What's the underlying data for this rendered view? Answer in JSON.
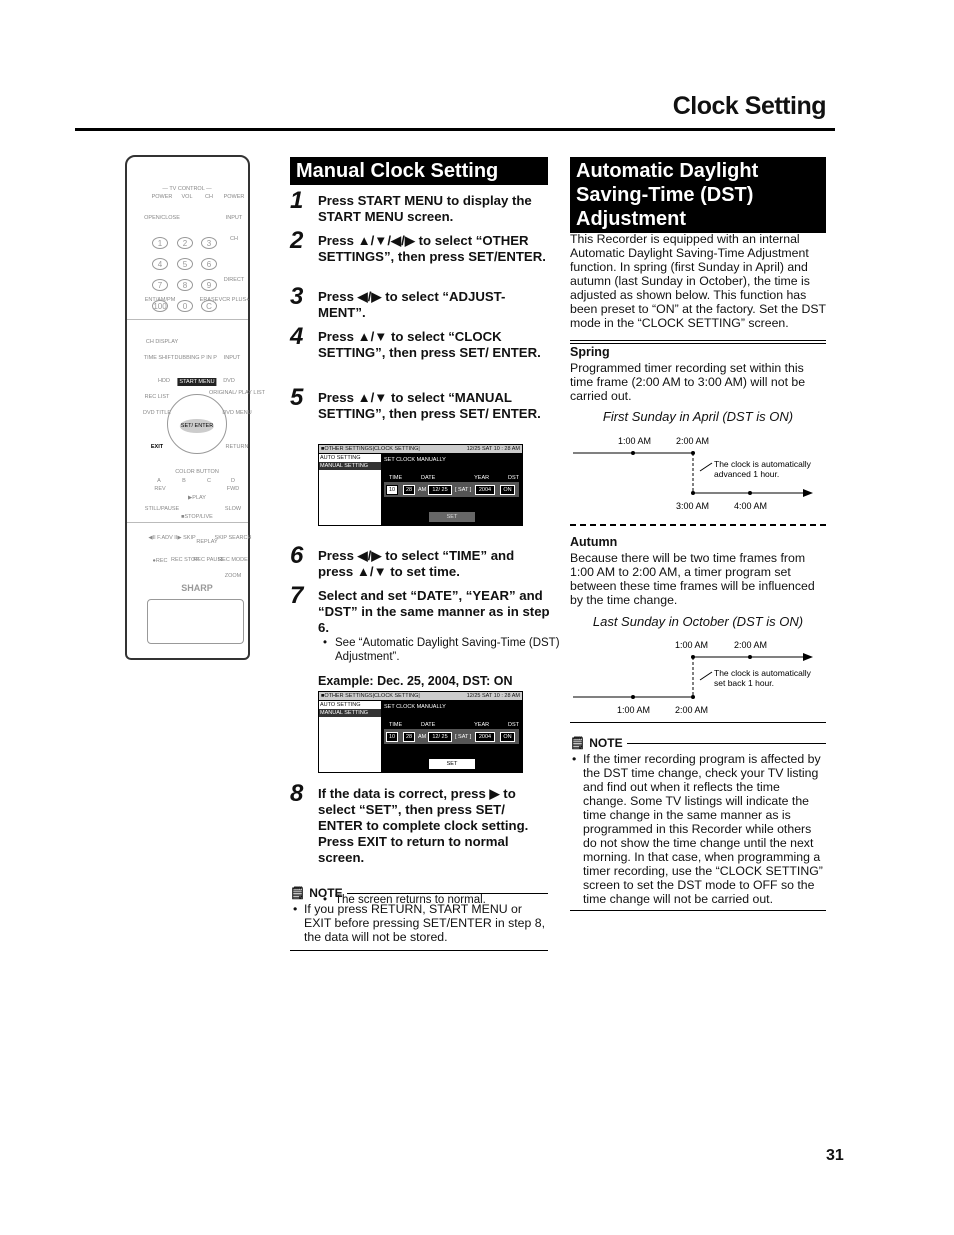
{
  "page": {
    "title": "Clock Setting",
    "page_number": "31"
  },
  "remote": {
    "labels": [
      "— TV CONTROL —",
      "POWER",
      "VOL",
      "CH",
      "POWER",
      "OPEN/CLOSE",
      "INPUT",
      "CH",
      "DIRECT",
      "ENT/AM/PM",
      "ERASE",
      "VCR PLUS+",
      "CH DISPLAY",
      "TIME SHIFT",
      "DUBBING",
      "P IN P",
      "INPUT",
      "HDD",
      "START MENU",
      "DVD",
      "REC LIST",
      "ORIGINAL/ PLAY LIST",
      "DVD TITLE",
      "DVD MENU",
      "SET/ ENTER",
      "EXIT",
      "RETURN",
      "COLOR BUTTON",
      "A",
      "B",
      "C",
      "D",
      "REV",
      "FWD",
      "▶PLAY",
      "STILL/PAUSE",
      "SLOW",
      "■STOP/LIVE",
      "◀II F.ADV II▶ SKIP",
      "REPLAY",
      "SKIP SEARCH",
      "●REC",
      "REC STOP",
      "REC PAUSE",
      "REC MODE",
      "ZOOM",
      "SHARP",
      "1",
      "2",
      "3",
      "4",
      "5",
      "6",
      "7",
      "8",
      "9",
      "100",
      "0",
      "C"
    ]
  },
  "manual": {
    "heading": "Manual Clock Setting",
    "steps": [
      {
        "n": "1",
        "html": "Press <b>START MENU</b> to display the START MENU screen."
      },
      {
        "n": "2",
        "html": "Press ▲/▼/◀/▶ to select “OTHER SETTINGS”, then press SET/ENTER."
      },
      {
        "n": "3",
        "html": "Press ◀/▶ to select “ADJUST-MENT”."
      },
      {
        "n": "4",
        "html": "Press ▲/▼ to select “CLOCK SETTING”, then press SET/ ENTER."
      },
      {
        "n": "5",
        "html": "Press ▲/▼ to select “MANUAL SETTING”, then press SET/ ENTER."
      },
      {
        "n": "6",
        "html": "Press ◀/▶  to select “TIME” and press ▲/▼ to set time."
      },
      {
        "n": "7",
        "html": "Select and set “DATE”, “YEAR” and “DST” in the same manner as in step 6."
      },
      {
        "n": "8",
        "html": "If the data is correct, press ▶ to select “SET”, then press SET/ ENTER to complete clock setting. Press EXIT to return to normal screen."
      }
    ],
    "step7_sub": "See “Automatic Daylight Saving-Time (DST) Adjustment”.",
    "example_label": "Example:",
    "example_text": " Dec. 25, 2004, DST: ON",
    "step8_sub": "The screen returns to normal.",
    "note_title": "NOTE",
    "note_text": "If you press RETURN, START MENU or EXIT before pressing SET/ENTER in step 8, the data will not be stored."
  },
  "screen": {
    "header_left": "■OTHER SETTINGS|CLOCK SETTING|",
    "header_right": "12/25  SAT  10 : 28  AM",
    "menu": [
      "AUTO SETTING",
      "MANUAL SETTING"
    ],
    "title": "SET CLOCK MANUALLY",
    "cols": [
      "TIME",
      "DATE",
      "YEAR",
      "DST"
    ],
    "hour": "10",
    "minute": "28",
    "ampm": "AM",
    "date": "12/ 25",
    "day": "[ SAT ]",
    "year": "2004",
    "dst": "ON",
    "set": "SET"
  },
  "dst": {
    "heading": "Automatic Daylight Saving-Time (DST) Adjustment",
    "intro": "This Recorder is equipped with an internal Automatic Daylight Saving-Time Adjustment function. In spring (first Sunday in April) and autumn (last Sunday in October), the time is adjusted as shown below. This function has been preset to “ON” at the factory. Set the DST mode in the “CLOCK SETTING” screen.",
    "spring_title": "Spring",
    "spring_text": "Programmed timer recording set within this time frame (2:00 AM to 3:00 AM) will not be carried out.",
    "spring_caption": "First Sunday in April (DST is ON)",
    "spring_top": [
      "1:00 AM",
      "2:00 AM"
    ],
    "spring_bottom": [
      "3:00 AM",
      "4:00 AM"
    ],
    "spring_note": [
      "The clock is automatically",
      "advanced 1 hour."
    ],
    "autumn_title": "Autumn",
    "autumn_text": "Because there will be two time frames from 1:00 AM to 2:00 AM, a timer program set between these time frames will be influenced by the time change.",
    "autumn_caption": "Last Sunday in October (DST is ON)",
    "autumn_top": [
      "1:00 AM",
      "2:00 AM"
    ],
    "autumn_bottom": [
      "1:00 AM",
      "2:00 AM"
    ],
    "autumn_note": [
      "The clock is automatically",
      "set back 1 hour."
    ],
    "note_title": "NOTE",
    "note_text": "If the timer recording program is affected by the DST time change, check your TV listing and find out when it reflects the time change. Some TV listings will indicate the time change in the same manner as is programmed in this Recorder while others do not show the time change until the next morning. In that case, when programming a timer recording, use the “CLOCK SETTING” screen to set the DST mode to OFF so the time change will not be carried out."
  }
}
